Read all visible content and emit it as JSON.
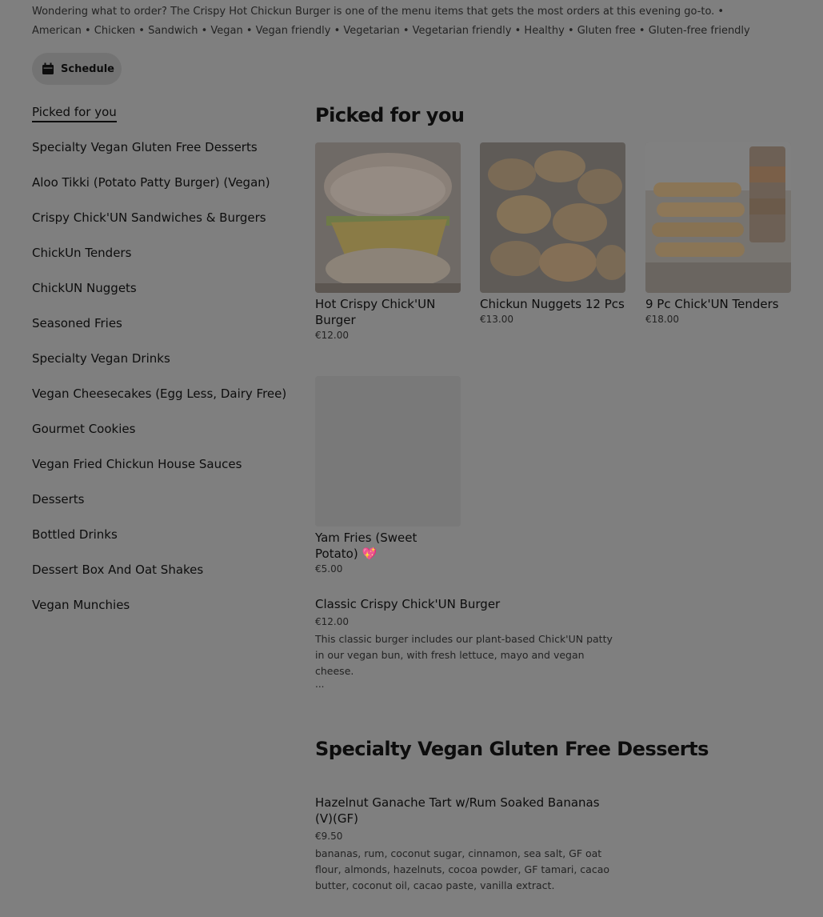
{
  "header": {
    "description": "Wondering what to order? The Crispy Hot Chickun Burger is one of the menu items that gets the most orders at this evening go-to. • American • Chicken • Sandwich • Vegan • Vegan friendly • Vegetarian • Vegetarian friendly • Healthy • Gluten free • Gluten-free friendly",
    "schedule_label": "Schedule",
    "schedule_icon": "calendar-icon"
  },
  "sidebar": {
    "items": [
      {
        "label": "Picked for you"
      },
      {
        "label": "Specialty Vegan Gluten Free Desserts"
      },
      {
        "label": "Aloo Tikki (Potato Patty Burger) (Vegan)"
      },
      {
        "label": "Crispy Chick'UN Sandwiches & Burgers"
      },
      {
        "label": "ChickUn Tenders"
      },
      {
        "label": "ChickUN Nuggets"
      },
      {
        "label": "Seasoned Fries"
      },
      {
        "label": "Specialty Vegan Drinks"
      },
      {
        "label": "Vegan Cheesecakes (Egg Less, Dairy Free)"
      },
      {
        "label": "Gourmet Cookies"
      },
      {
        "label": "Vegan Fried Chickun House Sauces"
      },
      {
        "label": "Desserts"
      },
      {
        "label": "Bottled Drinks"
      },
      {
        "label": "Dessert Box And Oat Shakes"
      },
      {
        "label": "Vegan Munchies"
      }
    ]
  },
  "picked": {
    "title": "Picked for you",
    "cards": [
      {
        "name": "Hot Crispy Chick'UN Burger",
        "price": "€12.00",
        "image": "burger"
      },
      {
        "name": "Chickun Nuggets 12 Pcs",
        "price": "€13.00",
        "image": "nuggets"
      },
      {
        "name": "9 Pc Chick'UN Tenders",
        "price": "€18.00",
        "image": "tenders"
      },
      {
        "name": "Yam Fries (Sweet Potato) 💖",
        "price": "€5.00",
        "image": "blank"
      }
    ],
    "list_item": {
      "name": "Classic Crispy Chick'UN Burger",
      "price": "€12.00",
      "description": "This classic burger includes our plant-based Chick'UN patty in our vegan bun, with fresh lettuce, mayo and vegan cheese.",
      "more": "..."
    }
  },
  "desserts": {
    "title": "Specialty Vegan Gluten Free Desserts",
    "item": {
      "name": "Hazelnut Ganache Tart w/Rum Soaked Bananas (V)(GF)",
      "price": "€9.50",
      "description": "bananas, rum, coconut sugar, cinnamon, sea salt, GF oat flour, almonds, hazelnuts, cocoa powder, GF tamari, cacao butter, coconut oil, cacao paste, vanilla extract."
    }
  },
  "colors": {
    "overlay_background": "#7f7f7f",
    "text": "#0d0d0d"
  }
}
